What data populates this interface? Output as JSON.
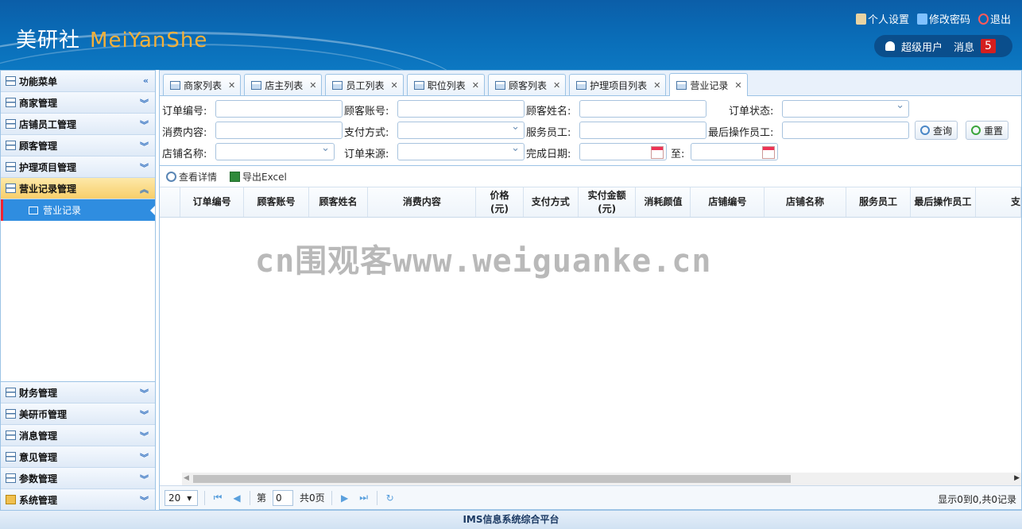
{
  "header": {
    "logo_cn": "美研社",
    "logo_en": "MeiYanShe",
    "links": {
      "settings": "个人设置",
      "password": "修改密码",
      "logout": "退出"
    },
    "user": "超级用户",
    "messages_label": "消息",
    "messages_count": "5"
  },
  "sidebar": {
    "title": "功能菜单",
    "collapse": "«",
    "items_top": [
      "商家管理",
      "店铺员工管理",
      "顾客管理",
      "护理项目管理"
    ],
    "active": "营业记录管理",
    "sub_item": "营业记录",
    "items_bottom": [
      "财务管理",
      "美研币管理",
      "消息管理",
      "意见管理",
      "参数管理",
      "系统管理"
    ]
  },
  "tabs": [
    {
      "label": "商家列表"
    },
    {
      "label": "店主列表"
    },
    {
      "label": "员工列表"
    },
    {
      "label": "职位列表"
    },
    {
      "label": "顾客列表"
    },
    {
      "label": "护理项目列表"
    },
    {
      "label": "营业记录",
      "active": true
    }
  ],
  "filters": {
    "order_no": "订单编号:",
    "customer_account": "顾客账号:",
    "customer_name": "顾客姓名:",
    "order_status": "订单状态:",
    "consume_content": "消费内容:",
    "pay_method": "支付方式:",
    "service_staff": "服务员工:",
    "last_staff": "最后操作员工:",
    "shop_name": "店铺名称:",
    "order_source": "订单来源:",
    "finish_date": "完成日期:",
    "to": "至:",
    "query": "查询",
    "reset": "重置"
  },
  "toolbar": {
    "detail": "查看详情",
    "export": "导出Excel"
  },
  "columns": [
    {
      "line1": "订单编号",
      "line2": ""
    },
    {
      "line1": "顾客账号",
      "line2": ""
    },
    {
      "line1": "顾客姓名",
      "line2": ""
    },
    {
      "line1": "消费内容",
      "line2": ""
    },
    {
      "line1": "价格",
      "line2": "(元)"
    },
    {
      "line1": "支付方式",
      "line2": ""
    },
    {
      "line1": "实付金额",
      "line2": "(元)"
    },
    {
      "line1": "消耗颜值",
      "line2": ""
    },
    {
      "line1": "店铺编号",
      "line2": ""
    },
    {
      "line1": "店铺名称",
      "line2": ""
    },
    {
      "line1": "服务员工",
      "line2": ""
    },
    {
      "line1": "最后操作员工",
      "line2": ""
    },
    {
      "line1": "支",
      "line2": ""
    }
  ],
  "watermark": "cn围观客www.weiguanke.cn",
  "pager": {
    "page_size": "20",
    "page_prefix": "第",
    "page_value": "0",
    "page_total": "共0页",
    "info": "显示0到0,共0记录"
  },
  "footer": "IMS信息系统综合平台",
  "colors": {
    "header": "#0a6db8",
    "accent": "#2f8de0",
    "active_menu": "#f8cf6a",
    "badge": "#d41e1e"
  }
}
